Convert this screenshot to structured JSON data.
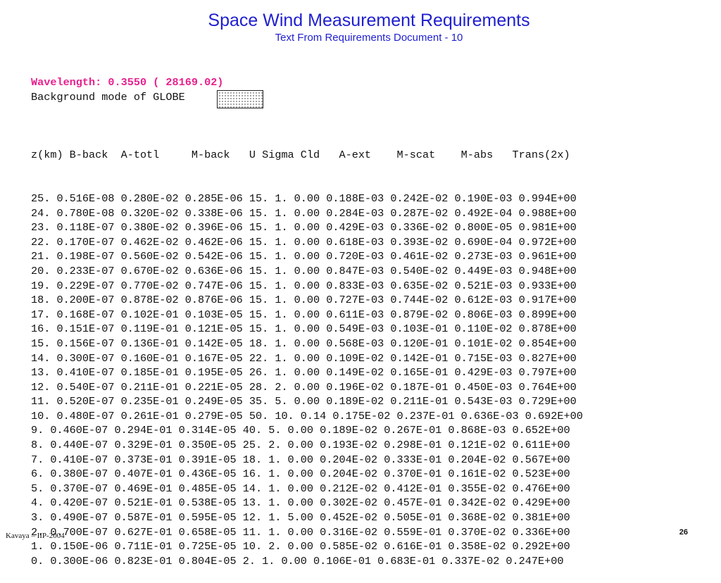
{
  "slide": {
    "title": "Space Wind Measurement Requirements",
    "subtitle": "Text From Requirements Document - 10",
    "footer": "Kavaya – IIP-2004",
    "page_number": "26"
  },
  "content": {
    "wavelength_line": "Wavelength: 0.3550 ( 28169.02)",
    "background_line": "Background mode of GLOBE",
    "table_header": "z(km) B-back  A-totl     M-back   U Sigma Cld   A-ext    M-scat    M-abs   Trans(2x)",
    "rows": [
      "25. 0.516E-08 0.280E-02 0.285E-06 15. 1. 0.00 0.188E-03 0.242E-02 0.190E-03 0.994E+00",
      "24. 0.780E-08 0.320E-02 0.338E-06 15. 1. 0.00 0.284E-03 0.287E-02 0.492E-04 0.988E+00",
      "23. 0.118E-07 0.380E-02 0.396E-06 15. 1. 0.00 0.429E-03 0.336E-02 0.800E-05 0.981E+00",
      "22. 0.170E-07 0.462E-02 0.462E-06 15. 1. 0.00 0.618E-03 0.393E-02 0.690E-04 0.972E+00",
      "21. 0.198E-07 0.560E-02 0.542E-06 15. 1. 0.00 0.720E-03 0.461E-02 0.273E-03 0.961E+00",
      "20. 0.233E-07 0.670E-02 0.636E-06 15. 1. 0.00 0.847E-03 0.540E-02 0.449E-03 0.948E+00",
      "19. 0.229E-07 0.770E-02 0.747E-06 15. 1. 0.00 0.833E-03 0.635E-02 0.521E-03 0.933E+00",
      "18. 0.200E-07 0.878E-02 0.876E-06 15. 1. 0.00 0.727E-03 0.744E-02 0.612E-03 0.917E+00",
      "17. 0.168E-07 0.102E-01 0.103E-05 15. 1. 0.00 0.611E-03 0.879E-02 0.806E-03 0.899E+00",
      "16. 0.151E-07 0.119E-01 0.121E-05 15. 1. 0.00 0.549E-03 0.103E-01 0.110E-02 0.878E+00",
      "15. 0.156E-07 0.136E-01 0.142E-05 18. 1. 0.00 0.568E-03 0.120E-01 0.101E-02 0.854E+00",
      "14. 0.300E-07 0.160E-01 0.167E-05 22. 1. 0.00 0.109E-02 0.142E-01 0.715E-03 0.827E+00",
      "13. 0.410E-07 0.185E-01 0.195E-05 26. 1. 0.00 0.149E-02 0.165E-01 0.429E-03 0.797E+00",
      "12. 0.540E-07 0.211E-01 0.221E-05 28. 2. 0.00 0.196E-02 0.187E-01 0.450E-03 0.764E+00",
      "11. 0.520E-07 0.235E-01 0.249E-05 35. 5. 0.00 0.189E-02 0.211E-01 0.543E-03 0.729E+00",
      "10. 0.480E-07 0.261E-01 0.279E-05 50. 10. 0.14 0.175E-02 0.237E-01 0.636E-03 0.692E+00",
      "9. 0.460E-07 0.294E-01 0.314E-05 40. 5. 0.00 0.189E-02 0.267E-01 0.868E-03 0.652E+00",
      "8. 0.440E-07 0.329E-01 0.350E-05 25. 2. 0.00 0.193E-02 0.298E-01 0.121E-02 0.611E+00",
      "7. 0.410E-07 0.373E-01 0.391E-05 18. 1. 0.00 0.204E-02 0.333E-01 0.204E-02 0.567E+00",
      "6. 0.380E-07 0.407E-01 0.436E-05 16. 1. 0.00 0.204E-02 0.370E-01 0.161E-02 0.523E+00",
      "5. 0.370E-07 0.469E-01 0.485E-05 14. 1. 0.00 0.212E-02 0.412E-01 0.355E-02 0.476E+00",
      "4. 0.420E-07 0.521E-01 0.538E-05 13. 1. 0.00 0.302E-02 0.457E-01 0.342E-02 0.429E+00",
      "3. 0.490E-07 0.587E-01 0.595E-05 12. 1. 5.00 0.452E-02 0.505E-01 0.368E-02 0.381E+00",
      "2. 0.700E-07 0.627E-01 0.658E-05 11. 1. 0.00 0.316E-02 0.559E-01 0.370E-02 0.336E+00",
      "1. 0.150E-06 0.711E-01 0.725E-05 10. 2. 0.00 0.585E-02 0.616E-01 0.358E-02 0.292E+00",
      "0. 0.300E-06 0.823E-01 0.804E-05 2. 1. 0.00 0.106E-01 0.683E-01 0.337E-02 0.247E+00"
    ]
  },
  "colors": {
    "title": "#1f1fcf",
    "wavelength": "#e8208e",
    "text": "#111111"
  }
}
